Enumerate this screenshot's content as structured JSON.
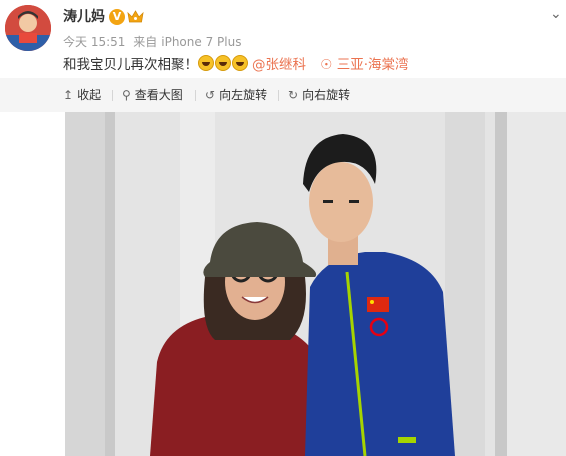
{
  "post": {
    "username": "涛儿妈",
    "verified_badge": "V",
    "badge_icon": "crown-icon",
    "time": "今天 15:51",
    "source_prefix": "来自",
    "source": "iPhone 7 Plus",
    "text": "和我宝贝儿再次相聚！",
    "emoji_count": 3,
    "mention": "@张继科",
    "location": "三亚·海棠湾"
  },
  "toolbar": {
    "collapse": "收起",
    "view_large": "查看大图",
    "rotate_left": "向左旋转",
    "rotate_right": "向右旋转"
  },
  "colors": {
    "accent": "#eb7350",
    "toolbar_bg": "#f5f5f5",
    "badge": "#f3a412"
  }
}
